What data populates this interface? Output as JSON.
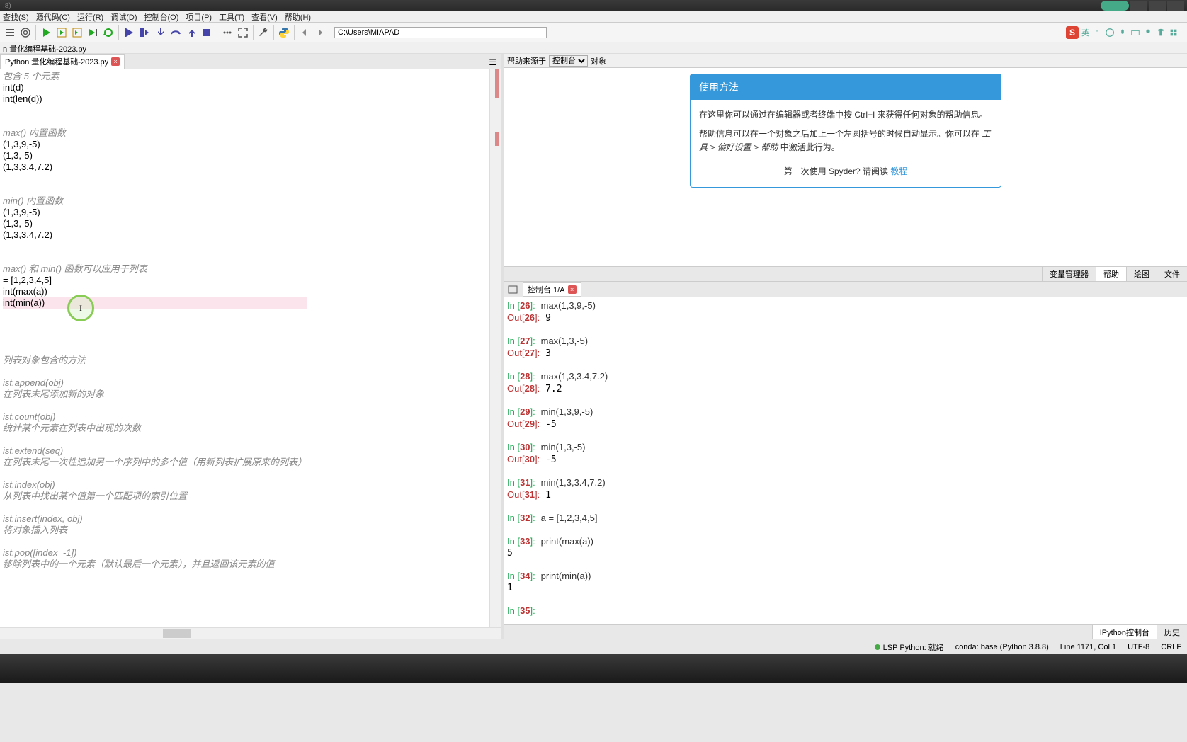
{
  "titlebar": {
    "text": ".8)"
  },
  "menus": [
    "查找(S)",
    "源代码(C)",
    "运行(R)",
    "调试(D)",
    "控制台(O)",
    "项目(P)",
    "工具(T)",
    "查看(V)",
    "帮助(H)"
  ],
  "path": "C:\\Users\\MIAPAD",
  "filepath": "n 量化编程基础-2023.py",
  "tab": {
    "name": "Python 量化编程基础-2023.py"
  },
  "editor_lines": [
    {
      "t": "包含 5 个元素",
      "c": "comment"
    },
    {
      "t": "int(d)",
      "c": "func"
    },
    {
      "t": "int(len(d))",
      "c": "func"
    },
    {
      "t": "",
      "c": ""
    },
    {
      "t": "",
      "c": ""
    },
    {
      "t": "max() 内置函数",
      "c": "comment"
    },
    {
      "t": "(1,3,9,-5)",
      "c": "func"
    },
    {
      "t": "(1,3,-5)",
      "c": "func"
    },
    {
      "t": "(1,3,3.4,7.2)",
      "c": "func"
    },
    {
      "t": "",
      "c": ""
    },
    {
      "t": "",
      "c": ""
    },
    {
      "t": "min() 内置函数",
      "c": "comment"
    },
    {
      "t": "(1,3,9,-5)",
      "c": "func"
    },
    {
      "t": "(1,3,-5)",
      "c": "func"
    },
    {
      "t": "(1,3,3.4,7.2)",
      "c": "func"
    },
    {
      "t": "",
      "c": ""
    },
    {
      "t": "",
      "c": ""
    },
    {
      "t": "max() 和 min() 函数可以应用于列表",
      "c": "comment"
    },
    {
      "t": "= [1,2,3,4,5]",
      "c": "func"
    },
    {
      "t": "int(max(a))",
      "c": "func"
    },
    {
      "t": "int(min(a))",
      "c": "func",
      "hl": true
    },
    {
      "t": "",
      "c": ""
    },
    {
      "t": "",
      "c": ""
    },
    {
      "t": "",
      "c": ""
    },
    {
      "t": "",
      "c": ""
    },
    {
      "t": "列表对象包含的方法",
      "c": "comment"
    },
    {
      "t": "",
      "c": ""
    },
    {
      "t": "ist.append(obj)",
      "c": "comment"
    },
    {
      "t": "在列表末尾添加新的对象",
      "c": "comment"
    },
    {
      "t": "",
      "c": ""
    },
    {
      "t": "ist.count(obj)",
      "c": "comment"
    },
    {
      "t": "统计某个元素在列表中出现的次数",
      "c": "comment"
    },
    {
      "t": "",
      "c": ""
    },
    {
      "t": "ist.extend(seq)",
      "c": "comment"
    },
    {
      "t": "在列表末尾一次性追加另一个序列中的多个值（用新列表扩展原来的列表）",
      "c": "comment"
    },
    {
      "t": "",
      "c": ""
    },
    {
      "t": "ist.index(obj)",
      "c": "comment"
    },
    {
      "t": "从列表中找出某个值第一个匹配项的索引位置",
      "c": "comment"
    },
    {
      "t": "",
      "c": ""
    },
    {
      "t": "ist.insert(index, obj)",
      "c": "comment"
    },
    {
      "t": "将对象插入列表",
      "c": "comment"
    },
    {
      "t": "",
      "c": ""
    },
    {
      "t": "ist.pop([index=-1])",
      "c": "comment"
    },
    {
      "t": "移除列表中的一个元素（默认最后一个元素），并且返回该元素的值",
      "c": "comment"
    }
  ],
  "help": {
    "source_label": "帮助来源于",
    "source_value": "控制台",
    "object_label": "对象",
    "title": "使用方法",
    "body1": "在这里你可以通过在编辑器或者终端中按 Ctrl+I 来获得任何对象的帮助信息。",
    "body2a": "帮助信息可以在一个对象之后加上一个左圆括号的时候自动显示。你可以在",
    "body2b": "工具 > 偏好设置 > 帮助",
    "body2c": " 中激活此行为。",
    "footer_a": "第一次使用 Spyder? 请阅读 ",
    "footer_link": "教程"
  },
  "panel_tabs": [
    "变量管理器",
    "帮助",
    "绘图",
    "文件"
  ],
  "console_tab": "控制台 1/A",
  "console": [
    {
      "in": "26",
      "code": "max(1,3,9,-5)",
      "out": "9"
    },
    {
      "in": "27",
      "code": "max(1,3,-5)",
      "out": "3"
    },
    {
      "in": "28",
      "code": "max(1,3,3.4,7.2)",
      "out": "7.2"
    },
    {
      "in": "29",
      "code": "min(1,3,9,-5)",
      "out": "-5"
    },
    {
      "in": "30",
      "code": "min(1,3,-5)",
      "out": "-5"
    },
    {
      "in": "31",
      "code": "min(1,3,3.4,7.2)",
      "out": "1"
    },
    {
      "in": "32",
      "code": "a = [1,2,3,4,5]",
      "out": null
    },
    {
      "in": "33",
      "code": "print(max(a))",
      "out": null,
      "print": "5"
    },
    {
      "in": "34",
      "code": "print(min(a))",
      "out": null,
      "print": "1"
    },
    {
      "in": "35",
      "code": "",
      "out": null
    }
  ],
  "bottom_tabs": [
    "IPython控制台",
    "历史"
  ],
  "status": {
    "lsp": "LSP Python: 就绪",
    "conda": "conda: base (Python 3.8.8)",
    "pos": "Line 1171, Col 1",
    "enc": "UTF-8",
    "eol": "CRLF"
  },
  "ime": {
    "s": "S",
    "lang": "英"
  }
}
